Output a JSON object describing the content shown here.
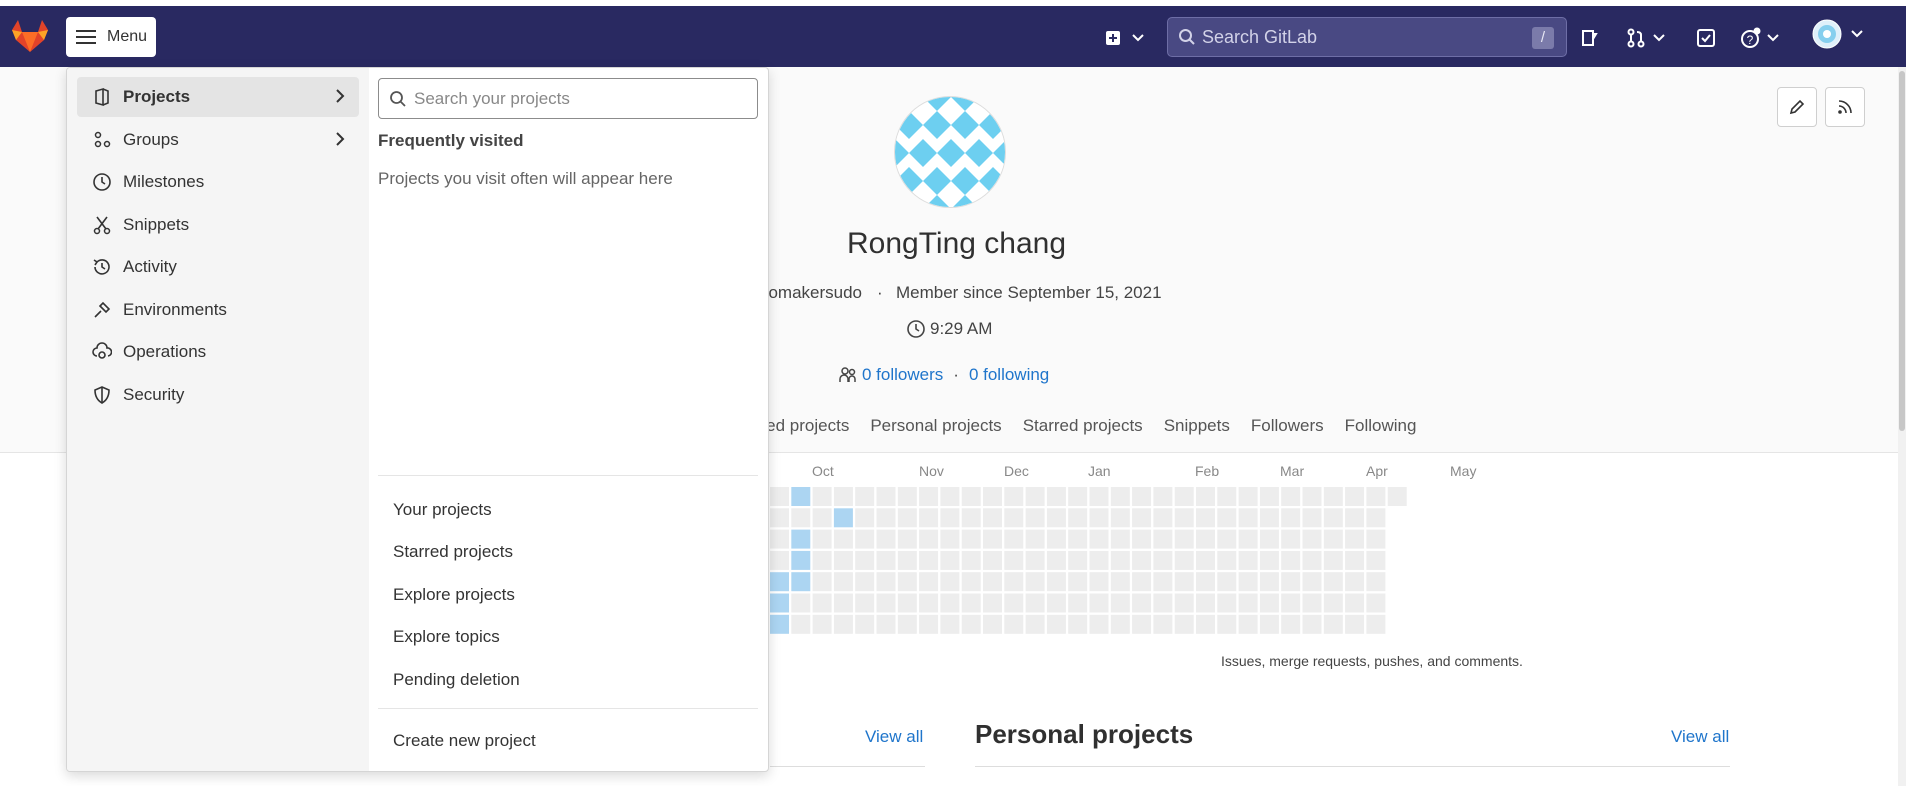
{
  "topbar": {
    "menu_label": "Menu",
    "search_placeholder": "Search GitLab",
    "search_shortcut": "/"
  },
  "profile": {
    "name": "RongTing chang",
    "username_partial": "eomakersudo",
    "separator": "·",
    "member_since": "Member since September 15, 2021",
    "local_time": "9:29 AM",
    "followers": "0 followers",
    "following": "0 following"
  },
  "profile_tabs": [
    "uted projects",
    "Personal projects",
    "Starred projects",
    "Snippets",
    "Followers",
    "Following"
  ],
  "calendar": {
    "months": [
      "Oct",
      "Nov",
      "Dec",
      "Jan",
      "Feb",
      "Mar",
      "Apr",
      "May"
    ],
    "note": "Issues, merge requests, pushes, and comments."
  },
  "sections": {
    "left_view_all": "View all",
    "personal_title": "Personal projects",
    "personal_view_all": "View all"
  },
  "dropdown": {
    "nav": [
      {
        "label": "Projects",
        "icon": "project-icon",
        "active": true,
        "chevron": true
      },
      {
        "label": "Groups",
        "icon": "group-icon",
        "active": false,
        "chevron": true
      },
      {
        "label": "Milestones",
        "icon": "clock-icon",
        "active": false,
        "chevron": false
      },
      {
        "label": "Snippets",
        "icon": "scissors-icon",
        "active": false,
        "chevron": false
      },
      {
        "label": "Activity",
        "icon": "history-icon",
        "active": false,
        "chevron": false
      },
      {
        "label": "Environments",
        "icon": "environment-icon",
        "active": false,
        "chevron": false
      },
      {
        "label": "Operations",
        "icon": "cloud-gear-icon",
        "active": false,
        "chevron": false
      },
      {
        "label": "Security",
        "icon": "shield-icon",
        "active": false,
        "chevron": false
      }
    ],
    "search_placeholder": "Search your projects",
    "frequent_title": "Frequently visited",
    "frequent_empty": "Projects you visit often will appear here",
    "links": [
      "Your projects",
      "Starred projects",
      "Explore projects",
      "Explore topics",
      "Pending deletion"
    ],
    "create_label": "Create new project"
  },
  "colors": {
    "topbar_bg": "#292961",
    "link": "#1f75cb",
    "contrib": "#acd5f2",
    "empty_cell": "#ededed"
  }
}
